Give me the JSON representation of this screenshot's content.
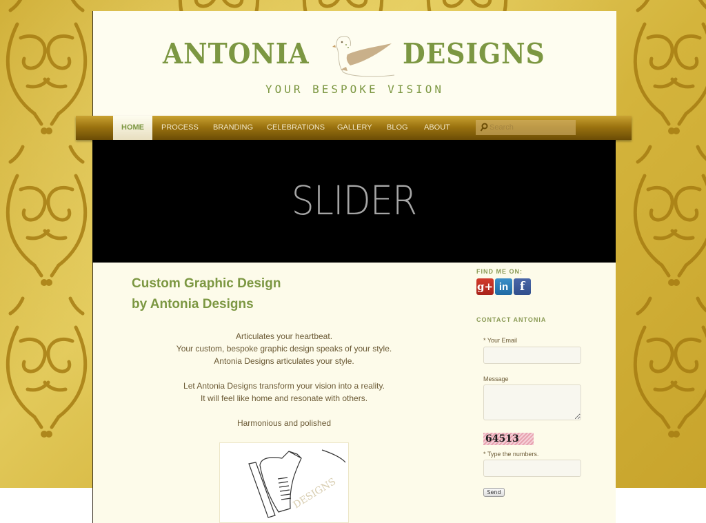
{
  "header": {
    "logo_left": "ANTONIA",
    "logo_right": "DESIGNS",
    "tagline": "YOUR BESPOKE VISION"
  },
  "nav": {
    "items": [
      {
        "label": "HOME",
        "active": true
      },
      {
        "label": "PROCESS"
      },
      {
        "label": "BRANDING"
      },
      {
        "label": "CELEBRATIONS"
      },
      {
        "label": "GALLERY"
      },
      {
        "label": "BLOG"
      },
      {
        "label": "ABOUT"
      }
    ],
    "search_placeholder": "Search"
  },
  "slider": {
    "label": "SLIDER"
  },
  "main": {
    "title_line1": "Custom Graphic Design",
    "title_line2": "by Antonia Designs",
    "paragraphs": [
      "Articulates your heartbeat.",
      "Your custom, bespoke graphic design speaks of your style.",
      "Antonia Designs articulates your style.",
      "",
      "Let Antonia Designs transform your vision into a reality.",
      "It will feel like home and resonate with others.",
      "",
      "Harmonious and polished"
    ],
    "image_watermark": "DESIGNS"
  },
  "sidebar": {
    "find_me_heading": "FIND ME ON:",
    "social": [
      {
        "name": "google-plus",
        "glyph": "g+"
      },
      {
        "name": "linkedin",
        "glyph": "in"
      },
      {
        "name": "facebook",
        "glyph": "f"
      }
    ],
    "contact_heading": "CONTACT ANTONIA",
    "email_label": "Your Email",
    "email_required": "*",
    "message_label": "Message",
    "captcha_code": "64513",
    "captcha_label": "Type the numbers.",
    "captcha_required": "*",
    "send_label": "Send"
  },
  "colors": {
    "brand_green": "#7c9742",
    "nav_gold": "#9c7410",
    "background_gold": "#d4b43c"
  }
}
